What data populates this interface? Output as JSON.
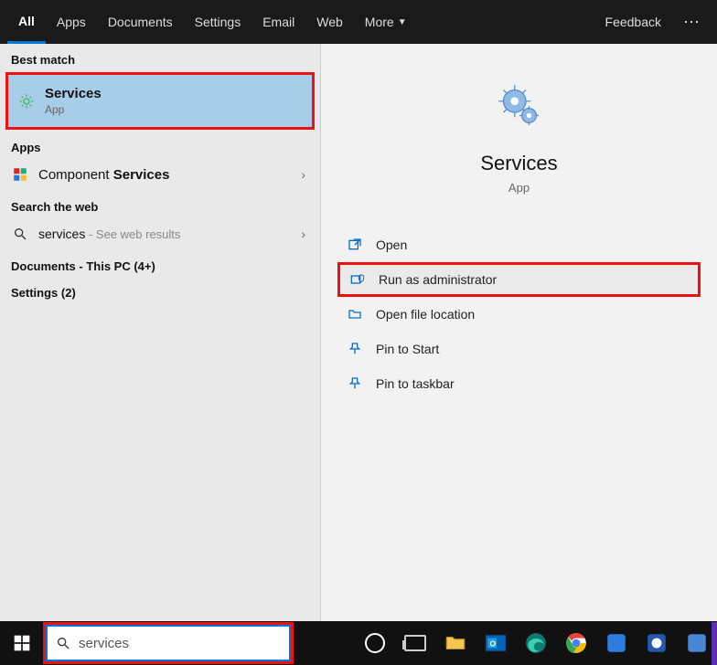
{
  "tabs": {
    "all": "All",
    "apps": "Apps",
    "documents": "Documents",
    "settings": "Settings",
    "email": "Email",
    "web": "Web",
    "more": "More",
    "feedback": "Feedback"
  },
  "sections": {
    "best": "Best match",
    "apps": "Apps",
    "web": "Search the web",
    "docs": "Documents - This PC (4+)",
    "settings": "Settings (2)"
  },
  "best": {
    "title": "Services",
    "sub": "App"
  },
  "apps_result": {
    "prefix": "Component ",
    "bold": "Services"
  },
  "web_result": {
    "query": "services",
    "hint": " - See web results"
  },
  "detail": {
    "title": "Services",
    "sub": "App"
  },
  "actions": {
    "open": "Open",
    "runadmin": "Run as administrator",
    "openloc": "Open file location",
    "pinstart": "Pin to Start",
    "pintask": "Pin to taskbar"
  },
  "search": {
    "value": "services"
  }
}
